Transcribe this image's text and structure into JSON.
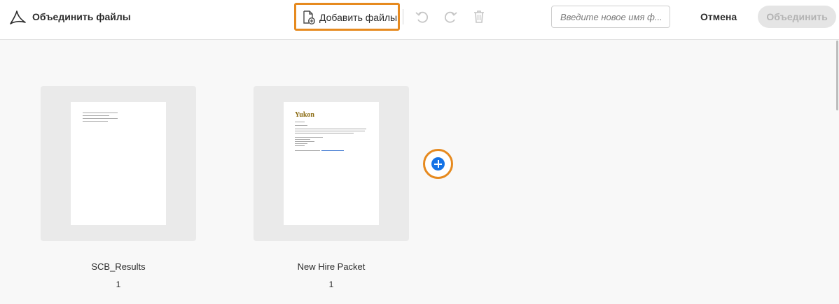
{
  "toolbar": {
    "app_title": "Объединить файлы",
    "add_files_label": "Добавить файлы",
    "name_input_placeholder": "Введите новое имя ф...",
    "name_input_value": "",
    "cancel_label": "Отмена",
    "merge_label": "Объединить",
    "icons": [
      "acrobat-logo-icon",
      "add-file-icon",
      "undo-icon",
      "redo-icon",
      "trash-icon"
    ]
  },
  "files": [
    {
      "name": "SCB_Results",
      "pages": "1",
      "preview_type": "text-lines"
    },
    {
      "name": "New Hire Packet",
      "pages": "1",
      "preview_type": "yukon-letter",
      "preview_logo": "Yukon"
    }
  ],
  "colors": {
    "highlight": "#e68a1f",
    "accent_blue": "#1473e6",
    "thumb_bg": "#eaeaea",
    "canvas_bg": "#f8f8f8",
    "disabled_button": "#e5e5e5"
  }
}
